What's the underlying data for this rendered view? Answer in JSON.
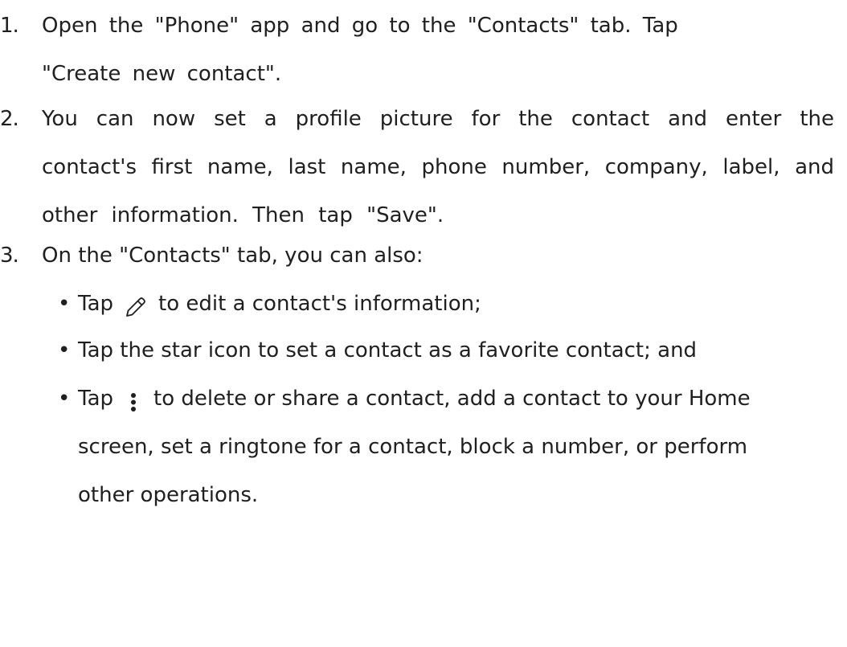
{
  "steps": [
    {
      "number": "1.",
      "text_part1": "Open the \"Phone\" app and go to the \"Contacts\" tab. Tap",
      "text_part2": "\"Create new contact\"."
    },
    {
      "number": "2.",
      "text": "You can now set a profile picture for the contact and enter the contact's first name, last name, phone number, company, label, and other information. Then tap \"Save\"."
    },
    {
      "number": "3.",
      "text": "On the \"Contacts\" tab, you can also:"
    }
  ],
  "bullets": [
    {
      "marker": "•",
      "prefix": "Tap",
      "icon": "pencil-edit-icon",
      "suffix": "to edit a contact's information;"
    },
    {
      "marker": "•",
      "text": "Tap the star icon to set a contact as a favorite contact; and"
    },
    {
      "marker": "•",
      "prefix": "Tap",
      "icon": "more-vertical-icon",
      "suffix": "to delete or share a contact, add a contact to your Home screen, set a ringtone for a contact, block a number, or perform other operations."
    }
  ],
  "colors": {
    "text": "#1f1f1f",
    "background": "#ffffff"
  }
}
